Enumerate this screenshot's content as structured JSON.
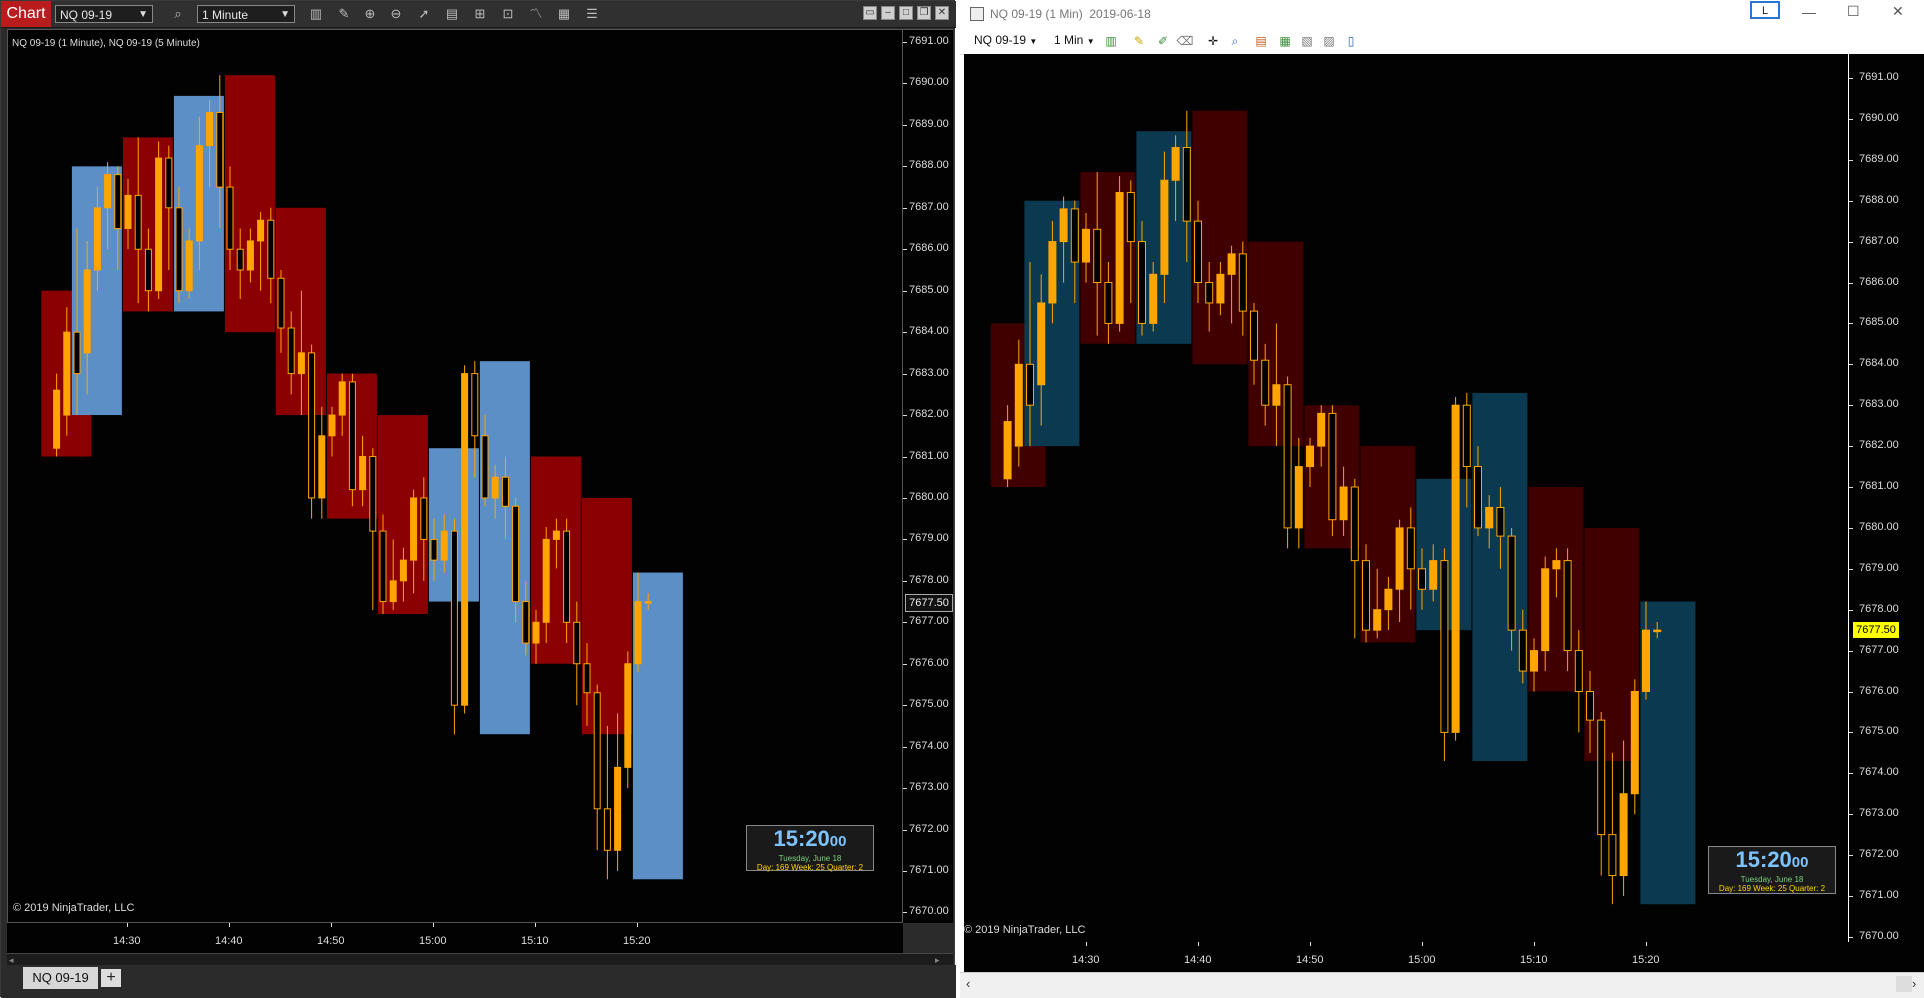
{
  "left": {
    "app_tab": "Chart",
    "instrument": "NQ 09-19",
    "interval": "1 Minute",
    "plot_title": "NQ 09-19 (1 Minute), NQ 09-19 (5 Minute)",
    "copyright": "© 2019 NinjaTrader, LLC",
    "bottom_tab": "NQ 09-19",
    "add_tab": "+",
    "price_flag": "7677.50",
    "clock": {
      "time": "15:20",
      "seconds": "00",
      "date": "Tuesday, June 18",
      "info": "Day: 169  Week: 25  Quarter: 2"
    }
  },
  "right": {
    "title": "NQ 09-19 (1 Min)  2019-06-18",
    "title_button": "L",
    "instrument": "NQ 09-19",
    "interval": "1 Min",
    "copyright": "© 2019 NinjaTrader, LLC",
    "price_flag": "7677.50",
    "clock": {
      "time": "15:20",
      "seconds": "00",
      "date": "Tuesday, June 18",
      "info": "Day: 169  Week: 25  Quarter: 2"
    }
  },
  "y_ticks": [
    "7691.00",
    "7690.00",
    "7689.00",
    "7688.00",
    "7687.00",
    "7686.00",
    "7685.00",
    "7684.00",
    "7683.00",
    "7682.00",
    "7681.00",
    "7680.00",
    "7679.00",
    "7678.00",
    "7677.00",
    "7676.00",
    "7675.00",
    "7674.00",
    "7673.00",
    "7672.00",
    "7671.00",
    "7670.00"
  ],
  "x_ticks": [
    "14:30",
    "14:40",
    "14:50",
    "15:00",
    "15:10",
    "15:20"
  ],
  "colors": {
    "left_up_box": "#5b8fc5",
    "left_down_box": "#8b0000",
    "right_up_box": "#0b3a50",
    "right_down_box": "#400000",
    "candle": "#ffa500",
    "flag_yellow": "#ffff00"
  },
  "chart_data": {
    "type": "candlestick",
    "ylim": [
      7669.5,
      7691.5
    ],
    "boxes_5min": [
      {
        "start": "14:22",
        "open": 7681,
        "close": 7685,
        "high": 7685,
        "low": 7681,
        "dir": "down"
      },
      {
        "start": "14:25",
        "open": 7682,
        "close": 7688,
        "high": 7688,
        "low": 7682,
        "dir": "up"
      },
      {
        "start": "14:30",
        "open": 7688.7,
        "close": 7684.5,
        "high": 7688.7,
        "low": 7684.5,
        "dir": "down"
      },
      {
        "start": "14:35",
        "open": 7684.5,
        "close": 7689.7,
        "high": 7689.7,
        "low": 7684.5,
        "dir": "up"
      },
      {
        "start": "14:40",
        "open": 7690.2,
        "close": 7684,
        "high": 7690.2,
        "low": 7684,
        "dir": "down"
      },
      {
        "start": "14:45",
        "open": 7687,
        "close": 7682,
        "high": 7687,
        "low": 7682,
        "dir": "down"
      },
      {
        "start": "14:50",
        "open": 7683,
        "close": 7679.5,
        "high": 7683,
        "low": 7679.5,
        "dir": "down"
      },
      {
        "start": "14:55",
        "open": 7682,
        "close": 7677.2,
        "high": 7682,
        "low": 7677.2,
        "dir": "down"
      },
      {
        "start": "15:00",
        "open": 7677.5,
        "close": 7681.2,
        "high": 7681.2,
        "low": 7677.5,
        "dir": "up"
      },
      {
        "start": "15:05",
        "open": 7674.3,
        "close": 7683.3,
        "high": 7683.3,
        "low": 7674.3,
        "dir": "up"
      },
      {
        "start": "15:10",
        "open": 7681,
        "close": 7676,
        "high": 7681,
        "low": 7676,
        "dir": "down"
      },
      {
        "start": "15:15",
        "open": 7680,
        "close": 7674.3,
        "high": 7680,
        "low": 7674.3,
        "dir": "down"
      },
      {
        "start": "15:20",
        "open": 7670.8,
        "close": 7678.2,
        "high": 7678.2,
        "low": 7670.8,
        "dir": "up"
      }
    ],
    "candles_1min": [
      [
        7681.2,
        7682.6,
        7683.0,
        7681.0
      ],
      [
        7682.0,
        7684.0,
        7684.6,
        7681.5
      ],
      [
        7684.0,
        7683.0,
        7686.5,
        7682.0
      ],
      [
        7683.5,
        7685.5,
        7686.2,
        7682.5
      ],
      [
        7685.5,
        7687.0,
        7687.5,
        7685.0
      ],
      [
        7687.0,
        7687.8,
        7688.1,
        7686.0
      ],
      [
        7687.8,
        7686.5,
        7688.0,
        7685.5
      ],
      [
        7686.5,
        7687.3,
        7687.7,
        7686.0
      ],
      [
        7687.3,
        7686.0,
        7688.7,
        7684.7
      ],
      [
        7686.0,
        7685.0,
        7686.5,
        7684.5
      ],
      [
        7685.0,
        7688.2,
        7688.6,
        7684.8
      ],
      [
        7688.2,
        7687.0,
        7688.5,
        7685.5
      ],
      [
        7687.0,
        7685.0,
        7687.5,
        7684.7
      ],
      [
        7685.0,
        7686.2,
        7686.5,
        7684.8
      ],
      [
        7686.2,
        7688.5,
        7689.2,
        7685.5
      ],
      [
        7688.5,
        7689.3,
        7689.6,
        7687.5
      ],
      [
        7689.3,
        7687.5,
        7690.2,
        7686.5
      ],
      [
        7687.5,
        7686.0,
        7688.0,
        7685.5
      ],
      [
        7686.0,
        7685.5,
        7686.5,
        7684.8
      ],
      [
        7685.5,
        7686.2,
        7686.5,
        7685.2
      ],
      [
        7686.2,
        7686.7,
        7686.9,
        7685.0
      ],
      [
        7686.7,
        7685.3,
        7687.0,
        7684.7
      ],
      [
        7685.3,
        7684.1,
        7685.5,
        7683.5
      ],
      [
        7684.1,
        7683.0,
        7684.5,
        7682.5
      ],
      [
        7683.0,
        7683.5,
        7685.0,
        7682.0
      ],
      [
        7683.5,
        7680.0,
        7683.7,
        7679.5
      ],
      [
        7680.0,
        7681.5,
        7682.2,
        7679.5
      ],
      [
        7681.5,
        7682.0,
        7682.2,
        7681.0
      ],
      [
        7682.0,
        7682.8,
        7683.0,
        7681.5
      ],
      [
        7682.8,
        7680.2,
        7683.0,
        7679.8
      ],
      [
        7680.2,
        7681.0,
        7681.5,
        7679.8
      ],
      [
        7681.0,
        7679.2,
        7681.2,
        7677.3
      ],
      [
        7679.2,
        7677.5,
        7679.6,
        7677.2
      ],
      [
        7677.5,
        7678.0,
        7679.0,
        7677.3
      ],
      [
        7678.0,
        7678.5,
        7678.8,
        7677.5
      ],
      [
        7678.5,
        7680.0,
        7680.2,
        7677.7
      ],
      [
        7680.0,
        7679.0,
        7680.5,
        7678.0
      ],
      [
        7679.0,
        7678.5,
        7679.5,
        7678.0
      ],
      [
        7678.5,
        7679.2,
        7679.6,
        7678.2
      ],
      [
        7679.2,
        7675.0,
        7679.5,
        7674.3
      ],
      [
        7675.0,
        7683.0,
        7683.2,
        7674.8
      ],
      [
        7683.0,
        7681.5,
        7683.3,
        7680.5
      ],
      [
        7681.5,
        7680.0,
        7682.0,
        7679.8
      ],
      [
        7680.0,
        7680.5,
        7680.8,
        7679.5
      ],
      [
        7680.5,
        7679.8,
        7681.0,
        7679.0
      ],
      [
        7679.8,
        7677.5,
        7680.0,
        7677.0
      ],
      [
        7677.5,
        7676.5,
        7678.0,
        7676.2
      ],
      [
        7676.5,
        7677.0,
        7677.3,
        7676.0
      ],
      [
        7677.0,
        7679.0,
        7679.3,
        7676.5
      ],
      [
        7679.0,
        7679.2,
        7679.5,
        7678.3
      ],
      [
        7679.2,
        7677.0,
        7679.5,
        7676.5
      ],
      [
        7677.0,
        7676.0,
        7677.5,
        7675.0
      ],
      [
        7676.0,
        7675.3,
        7676.5,
        7674.5
      ],
      [
        7675.3,
        7672.5,
        7675.5,
        7671.5
      ],
      [
        7672.5,
        7671.5,
        7674.5,
        7670.8
      ],
      [
        7671.5,
        7673.5,
        7674.8,
        7671.0
      ],
      [
        7673.5,
        7676.0,
        7676.3,
        7673.0
      ],
      [
        7676.0,
        7677.5,
        7678.2,
        7675.8
      ],
      [
        7677.5,
        7677.5,
        7677.7,
        7677.3
      ]
    ]
  }
}
